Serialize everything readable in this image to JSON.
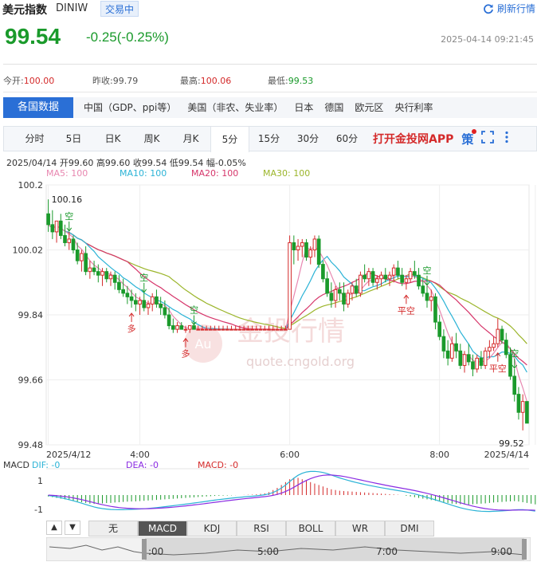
{
  "header": {
    "name": "美元指数",
    "code": "DINIW",
    "status": "交易中",
    "refresh_label": "刷新行情",
    "price": "99.54",
    "change": "-0.25(-0.25%)",
    "timestamp": "2025-04-14 09:21:45"
  },
  "stats": [
    {
      "label": "今开:",
      "value": "100.00",
      "color": "#d42a2a"
    },
    {
      "label": "昨收:",
      "value": "99.79",
      "color": "#555555"
    },
    {
      "label": "最高:",
      "value": "100.06",
      "color": "#d42a2a"
    },
    {
      "label": "最低:",
      "value": "99.53",
      "color": "#1a9a2b"
    }
  ],
  "nav": {
    "active": "各国数据",
    "items": [
      "中国（GDP、ppi等）",
      "美国（非农、失业率）",
      "日本",
      "德国",
      "欧元区",
      "央行利率"
    ]
  },
  "tabs": {
    "items": [
      "分时",
      "5日",
      "日K",
      "周K",
      "月K",
      "5分",
      "15分",
      "30分",
      "60分"
    ],
    "active_index": 5,
    "app_link": "打开金投网APP",
    "strategy_label": "策"
  },
  "ohlc": {
    "date": "2025/04/14",
    "open_label": "开",
    "open": "99.60",
    "high_label": "高",
    "high": "99.60",
    "close_label": "收",
    "close": "99.54",
    "low_label": "低",
    "low": "99.54",
    "range_label": "幅",
    "range": "-0.05%"
  },
  "ma_legend": [
    {
      "label": "MA5:",
      "value": "100",
      "color": "#e887b0"
    },
    {
      "label": "MA10:",
      "value": "100",
      "color": "#2bb3d6"
    },
    {
      "label": "MA20:",
      "value": "100",
      "color": "#d6356a"
    },
    {
      "label": "MA30:",
      "value": "100",
      "color": "#9bb52a"
    }
  ],
  "watermark": {
    "text": "金投行情",
    "url": "quote.cngold.org",
    "logo": "Au"
  },
  "chart_data": {
    "type": "candlestick",
    "y_ticks": [
      "100.2",
      "100.02",
      "99.84",
      "99.66",
      "99.48"
    ],
    "ylim": [
      99.48,
      100.2
    ],
    "x_ticks": [
      {
        "label": "2025/4/12",
        "index": 0
      },
      {
        "label": "4:00",
        "index": 22
      },
      {
        "label": "6:00",
        "index": 58
      },
      {
        "label": "8:00",
        "index": 94
      },
      {
        "label": "2025/4/14",
        "index": 117
      }
    ],
    "annotations": {
      "high": "100.16",
      "low": "99.52"
    },
    "signal_labels": {
      "sell": "空",
      "buy": "多",
      "close_short": "平空"
    },
    "signals": [
      {
        "type": "sell",
        "index": 5
      },
      {
        "type": "buy",
        "index": 20
      },
      {
        "type": "sell",
        "index": 23
      },
      {
        "type": "buy",
        "index": 33
      },
      {
        "type": "sell",
        "index": 35
      },
      {
        "type": "close_short",
        "index": 86
      },
      {
        "type": "sell",
        "index": 91
      },
      {
        "type": "close_short",
        "index": 108
      },
      {
        "type": "sell",
        "index": 112
      }
    ],
    "candles": [
      [
        100.12,
        100.16,
        100.07,
        100.09
      ],
      [
        100.09,
        100.13,
        100.05,
        100.07
      ],
      [
        100.07,
        100.1,
        100.04,
        100.1
      ],
      [
        100.1,
        100.12,
        100.05,
        100.06
      ],
      [
        100.06,
        100.09,
        100.03,
        100.04
      ],
      [
        100.04,
        100.07,
        100.02,
        100.05
      ],
      [
        100.05,
        100.06,
        100.01,
        100.02
      ],
      [
        100.02,
        100.04,
        99.98,
        99.99
      ],
      [
        99.99,
        100.02,
        99.96,
        100.01
      ],
      [
        100.01,
        100.03,
        99.95,
        99.96
      ],
      [
        99.96,
        99.99,
        99.94,
        99.97
      ],
      [
        99.97,
        99.99,
        99.95,
        99.96
      ],
      [
        99.96,
        99.98,
        99.93,
        99.95
      ],
      [
        99.95,
        99.97,
        99.92,
        99.96
      ],
      [
        99.96,
        99.97,
        99.93,
        99.94
      ],
      [
        99.94,
        99.96,
        99.92,
        99.95
      ],
      [
        99.95,
        99.96,
        99.91,
        99.93
      ],
      [
        99.93,
        99.95,
        99.9,
        99.91
      ],
      [
        99.91,
        99.94,
        99.89,
        99.9
      ],
      [
        99.9,
        99.92,
        99.87,
        99.89
      ],
      [
        99.89,
        99.91,
        99.86,
        99.88
      ],
      [
        99.88,
        99.9,
        99.85,
        99.87
      ],
      [
        99.87,
        99.89,
        99.84,
        99.88
      ],
      [
        99.88,
        99.9,
        99.85,
        99.86
      ],
      [
        99.86,
        99.88,
        99.84,
        99.87
      ],
      [
        99.87,
        99.9,
        99.85,
        99.89
      ],
      [
        99.89,
        99.91,
        99.86,
        99.87
      ],
      [
        99.87,
        99.89,
        99.84,
        99.86
      ],
      [
        99.86,
        99.88,
        99.83,
        99.84
      ],
      [
        99.84,
        99.86,
        99.8,
        99.81
      ],
      [
        99.81,
        99.83,
        99.79,
        99.8
      ],
      [
        99.8,
        99.82,
        99.79,
        99.81
      ],
      [
        99.81,
        99.82,
        99.8,
        99.8
      ],
      [
        99.8,
        99.81,
        99.79,
        99.8
      ],
      [
        99.8,
        99.81,
        99.79,
        99.81
      ],
      [
        99.81,
        99.81,
        99.8,
        99.8
      ],
      [
        99.8,
        99.81,
        99.8,
        99.8
      ],
      [
        99.8,
        99.81,
        99.8,
        99.8
      ],
      [
        99.8,
        99.81,
        99.8,
        99.8
      ],
      [
        99.8,
        99.81,
        99.8,
        99.8
      ],
      [
        99.8,
        99.81,
        99.8,
        99.8
      ],
      [
        99.8,
        99.81,
        99.8,
        99.8
      ],
      [
        99.8,
        99.81,
        99.8,
        99.8
      ],
      [
        99.8,
        99.81,
        99.8,
        99.8
      ],
      [
        99.8,
        99.81,
        99.8,
        99.8
      ],
      [
        99.8,
        99.81,
        99.8,
        99.8
      ],
      [
        99.8,
        99.81,
        99.8,
        99.8
      ],
      [
        99.8,
        99.81,
        99.8,
        99.8
      ],
      [
        99.8,
        99.81,
        99.8,
        99.8
      ],
      [
        99.8,
        99.81,
        99.8,
        99.8
      ],
      [
        99.8,
        99.81,
        99.8,
        99.8
      ],
      [
        99.8,
        99.81,
        99.8,
        99.8
      ],
      [
        99.8,
        99.81,
        99.8,
        99.8
      ],
      [
        99.8,
        99.81,
        99.8,
        99.8
      ],
      [
        99.8,
        99.81,
        99.8,
        99.8
      ],
      [
        99.8,
        99.81,
        99.8,
        99.8
      ],
      [
        99.8,
        99.81,
        99.8,
        99.8
      ],
      [
        99.8,
        99.81,
        99.8,
        99.8
      ],
      [
        99.8,
        100.06,
        99.8,
        100.04
      ],
      [
        100.04,
        100.06,
        99.98,
        100.02
      ],
      [
        100.02,
        100.05,
        99.99,
        100.03
      ],
      [
        100.03,
        100.05,
        100.0,
        100.04
      ],
      [
        100.04,
        100.05,
        99.99,
        100.0
      ],
      [
        100.0,
        100.03,
        99.98,
        100.02
      ],
      [
        100.02,
        100.06,
        100.0,
        100.05
      ],
      [
        100.05,
        100.06,
        99.97,
        99.98
      ],
      [
        99.98,
        99.99,
        99.93,
        99.94
      ],
      [
        99.94,
        99.96,
        99.89,
        99.9
      ],
      [
        99.9,
        99.93,
        99.86,
        99.88
      ],
      [
        99.88,
        99.92,
        99.86,
        99.91
      ],
      [
        99.91,
        99.93,
        99.88,
        99.9
      ],
      [
        99.9,
        99.93,
        99.85,
        99.87
      ],
      [
        99.87,
        99.91,
        99.86,
        99.9
      ],
      [
        99.9,
        99.93,
        99.88,
        99.92
      ],
      [
        99.92,
        99.94,
        99.89,
        99.9
      ],
      [
        99.9,
        99.96,
        99.89,
        99.95
      ],
      [
        99.95,
        99.98,
        99.93,
        99.94
      ],
      [
        99.94,
        99.97,
        99.92,
        99.96
      ],
      [
        99.96,
        99.97,
        99.92,
        99.93
      ],
      [
        99.93,
        99.95,
        99.91,
        99.94
      ],
      [
        99.94,
        99.96,
        99.92,
        99.95
      ],
      [
        99.95,
        99.97,
        99.93,
        99.94
      ],
      [
        99.94,
        99.96,
        99.92,
        99.95
      ],
      [
        99.95,
        99.98,
        99.93,
        99.97
      ],
      [
        99.97,
        99.99,
        99.94,
        99.95
      ],
      [
        99.95,
        99.97,
        99.92,
        99.93
      ],
      [
        99.93,
        99.95,
        99.91,
        99.94
      ],
      [
        99.94,
        99.97,
        99.93,
        99.96
      ],
      [
        99.96,
        99.99,
        99.94,
        99.95
      ],
      [
        99.95,
        99.97,
        99.91,
        99.92
      ],
      [
        99.92,
        99.94,
        99.89,
        99.9
      ],
      [
        99.9,
        99.92,
        99.86,
        99.88
      ],
      [
        99.88,
        99.91,
        99.85,
        99.89
      ],
      [
        99.89,
        99.9,
        99.8,
        99.82
      ],
      [
        99.82,
        99.84,
        99.77,
        99.78
      ],
      [
        99.78,
        99.8,
        99.72,
        99.74
      ],
      [
        99.74,
        99.77,
        99.7,
        99.72
      ],
      [
        99.72,
        99.78,
        99.71,
        99.76
      ],
      [
        99.76,
        99.79,
        99.72,
        99.74
      ],
      [
        99.74,
        99.76,
        99.69,
        99.7
      ],
      [
        99.7,
        99.74,
        99.68,
        99.73
      ],
      [
        99.73,
        99.76,
        99.7,
        99.71
      ],
      [
        99.71,
        99.73,
        99.67,
        99.69
      ],
      [
        99.69,
        99.73,
        99.68,
        99.72
      ],
      [
        99.72,
        99.74,
        99.69,
        99.7
      ],
      [
        99.7,
        99.75,
        99.69,
        99.74
      ],
      [
        99.74,
        99.77,
        99.72,
        99.75
      ],
      [
        99.75,
        99.78,
        99.74,
        99.76
      ],
      [
        99.76,
        99.83,
        99.75,
        99.8
      ],
      [
        99.8,
        99.81,
        99.76,
        99.77
      ],
      [
        99.77,
        99.79,
        99.72,
        99.73
      ],
      [
        99.73,
        99.75,
        99.66,
        99.67
      ],
      [
        99.67,
        99.69,
        99.6,
        99.62
      ],
      [
        99.62,
        99.64,
        99.55,
        99.57
      ],
      [
        99.57,
        99.62,
        99.52,
        99.6
      ],
      [
        99.6,
        99.6,
        99.54,
        99.54
      ]
    ],
    "macd_ticks": [
      "1",
      "-1"
    ],
    "macd_legend": [
      {
        "label": "MACD",
        "value": "",
        "color": "#333333"
      },
      {
        "label": "DIF:",
        "value": "-0",
        "color": "#2bb3d6"
      },
      {
        "label": "DEA:",
        "value": "-0",
        "color": "#8a2be2"
      },
      {
        "label": "MACD:",
        "value": "-0",
        "color": "#d42a2a"
      }
    ],
    "macd_hist": [
      -0.1,
      -0.15,
      -0.2,
      -0.25,
      -0.3,
      -0.35,
      -0.4,
      -0.45,
      -0.5,
      -0.55,
      -0.6,
      -0.62,
      -0.6,
      -0.58,
      -0.56,
      -0.55,
      -0.52,
      -0.5,
      -0.48,
      -0.46,
      -0.45,
      -0.44,
      -0.42,
      -0.4,
      -0.38,
      -0.36,
      -0.34,
      -0.32,
      -0.3,
      -0.28,
      -0.26,
      -0.24,
      -0.22,
      -0.2,
      -0.18,
      -0.16,
      -0.14,
      -0.12,
      -0.1,
      -0.08,
      -0.06,
      -0.05,
      -0.04,
      -0.03,
      -0.02,
      -0.01,
      0,
      0.01,
      0.02,
      0.03,
      0.05,
      0.08,
      0.12,
      0.2,
      0.35,
      0.5,
      0.7,
      0.9,
      1.1,
      1.2,
      1.2,
      1.1,
      1.0,
      0.9,
      0.8,
      0.7,
      0.6,
      0.5,
      0.4,
      0.35,
      0.3,
      0.28,
      0.26,
      0.24,
      0.22,
      0.2,
      0.18,
      0.16,
      0.14,
      0.12,
      0.1,
      0.08,
      0.06,
      0.04,
      0.02,
      0,
      -0.05,
      -0.1,
      -0.15,
      -0.2,
      -0.25,
      -0.3,
      -0.35,
      -0.4,
      -0.45,
      -0.5,
      -0.55,
      -0.6,
      -0.62,
      -0.64,
      -0.65,
      -0.66,
      -0.64,
      -0.62,
      -0.6,
      -0.58,
      -0.55,
      -0.52,
      -0.5,
      -0.48,
      -0.46,
      -0.44,
      -0.42,
      -0.45,
      -0.5,
      -0.55,
      -0.6,
      -0.65
    ]
  },
  "macd_tabs": {
    "up_label": "▲",
    "down_label": "▼",
    "items": [
      "无",
      "MACD",
      "KDJ",
      "RSI",
      "BOLL",
      "WR",
      "DMI"
    ],
    "active_index": 1
  },
  "navigator": {
    "labels": [
      ":00",
      "5:00",
      "7:00",
      "9:00"
    ]
  }
}
